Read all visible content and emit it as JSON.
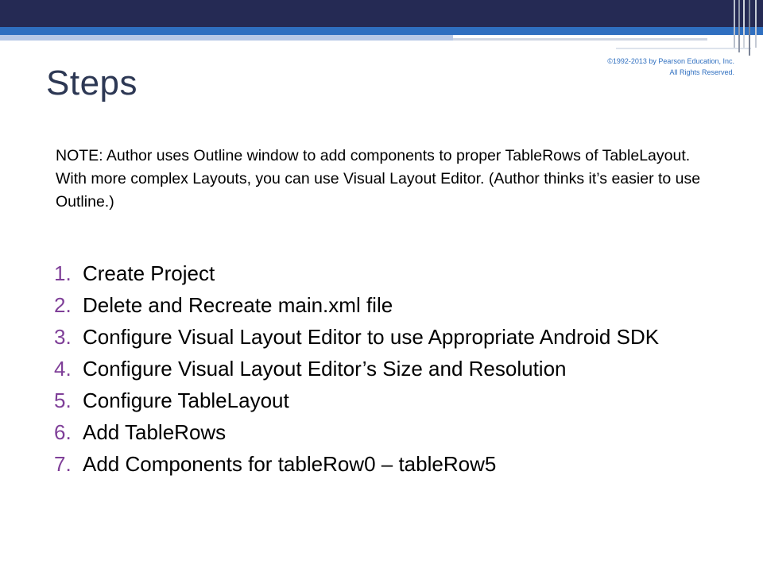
{
  "slide": {
    "title": "Steps",
    "copyright": "©1992-2013 by Pearson Education, Inc. All Rights Reserved.",
    "note": "NOTE: Author uses Outline window to add components to proper TableRows of TableLayout. With more complex Layouts, you can use Visual Layout Editor.  (Author thinks it’s easier to use Outline.)",
    "steps": [
      {
        "number": "1.",
        "text": "Create Project"
      },
      {
        "number": "2.",
        "text": "Delete and Recreate main.xml file"
      },
      {
        "number": "3.",
        "text": "Configure Visual Layout Editor to use Appropriate Android SDK"
      },
      {
        "number": "4.",
        "text": "Configure Visual Layout Editor’s Size and Resolution"
      },
      {
        "number": "5.",
        "text": "Configure TableLayout"
      },
      {
        "number": "6.",
        "text": "Add TableRows"
      },
      {
        "number": "7.",
        "text": "Add Components for tableRow0 – tableRow5"
      }
    ]
  },
  "colors": {
    "header_dark": "#252a54",
    "header_blue": "#2f6fc0",
    "title": "#2d3854",
    "step_number": "#7f3f98"
  }
}
